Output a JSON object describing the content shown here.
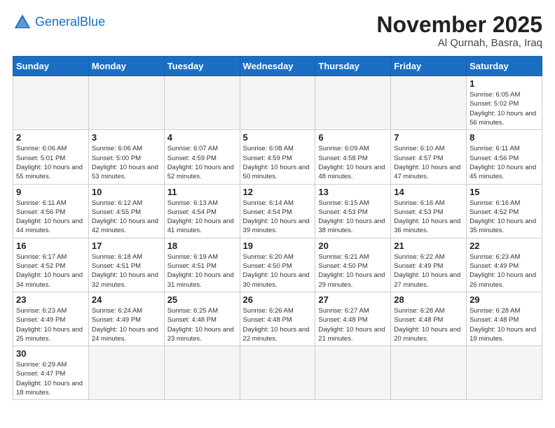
{
  "header": {
    "logo_general": "General",
    "logo_blue": "Blue",
    "month_title": "November 2025",
    "subtitle": "Al Qurnah, Basra, Iraq"
  },
  "weekdays": [
    "Sunday",
    "Monday",
    "Tuesday",
    "Wednesday",
    "Thursday",
    "Friday",
    "Saturday"
  ],
  "weeks": [
    [
      {
        "day": "",
        "info": ""
      },
      {
        "day": "",
        "info": ""
      },
      {
        "day": "",
        "info": ""
      },
      {
        "day": "",
        "info": ""
      },
      {
        "day": "",
        "info": ""
      },
      {
        "day": "",
        "info": ""
      },
      {
        "day": "1",
        "info": "Sunrise: 6:05 AM\nSunset: 5:02 PM\nDaylight: 10 hours and 56 minutes."
      }
    ],
    [
      {
        "day": "2",
        "info": "Sunrise: 6:06 AM\nSunset: 5:01 PM\nDaylight: 10 hours and 55 minutes."
      },
      {
        "day": "3",
        "info": "Sunrise: 6:06 AM\nSunset: 5:00 PM\nDaylight: 10 hours and 53 minutes."
      },
      {
        "day": "4",
        "info": "Sunrise: 6:07 AM\nSunset: 4:59 PM\nDaylight: 10 hours and 52 minutes."
      },
      {
        "day": "5",
        "info": "Sunrise: 6:08 AM\nSunset: 4:59 PM\nDaylight: 10 hours and 50 minutes."
      },
      {
        "day": "6",
        "info": "Sunrise: 6:09 AM\nSunset: 4:58 PM\nDaylight: 10 hours and 48 minutes."
      },
      {
        "day": "7",
        "info": "Sunrise: 6:10 AM\nSunset: 4:57 PM\nDaylight: 10 hours and 47 minutes."
      },
      {
        "day": "8",
        "info": "Sunrise: 6:11 AM\nSunset: 4:56 PM\nDaylight: 10 hours and 45 minutes."
      }
    ],
    [
      {
        "day": "9",
        "info": "Sunrise: 6:11 AM\nSunset: 4:56 PM\nDaylight: 10 hours and 44 minutes."
      },
      {
        "day": "10",
        "info": "Sunrise: 6:12 AM\nSunset: 4:55 PM\nDaylight: 10 hours and 42 minutes."
      },
      {
        "day": "11",
        "info": "Sunrise: 6:13 AM\nSunset: 4:54 PM\nDaylight: 10 hours and 41 minutes."
      },
      {
        "day": "12",
        "info": "Sunrise: 6:14 AM\nSunset: 4:54 PM\nDaylight: 10 hours and 39 minutes."
      },
      {
        "day": "13",
        "info": "Sunrise: 6:15 AM\nSunset: 4:53 PM\nDaylight: 10 hours and 38 minutes."
      },
      {
        "day": "14",
        "info": "Sunrise: 6:16 AM\nSunset: 4:53 PM\nDaylight: 10 hours and 36 minutes."
      },
      {
        "day": "15",
        "info": "Sunrise: 6:16 AM\nSunset: 4:52 PM\nDaylight: 10 hours and 35 minutes."
      }
    ],
    [
      {
        "day": "16",
        "info": "Sunrise: 6:17 AM\nSunset: 4:52 PM\nDaylight: 10 hours and 34 minutes."
      },
      {
        "day": "17",
        "info": "Sunrise: 6:18 AM\nSunset: 4:51 PM\nDaylight: 10 hours and 32 minutes."
      },
      {
        "day": "18",
        "info": "Sunrise: 6:19 AM\nSunset: 4:51 PM\nDaylight: 10 hours and 31 minutes."
      },
      {
        "day": "19",
        "info": "Sunrise: 6:20 AM\nSunset: 4:50 PM\nDaylight: 10 hours and 30 minutes."
      },
      {
        "day": "20",
        "info": "Sunrise: 6:21 AM\nSunset: 4:50 PM\nDaylight: 10 hours and 29 minutes."
      },
      {
        "day": "21",
        "info": "Sunrise: 6:22 AM\nSunset: 4:49 PM\nDaylight: 10 hours and 27 minutes."
      },
      {
        "day": "22",
        "info": "Sunrise: 6:23 AM\nSunset: 4:49 PM\nDaylight: 10 hours and 26 minutes."
      }
    ],
    [
      {
        "day": "23",
        "info": "Sunrise: 6:23 AM\nSunset: 4:49 PM\nDaylight: 10 hours and 25 minutes."
      },
      {
        "day": "24",
        "info": "Sunrise: 6:24 AM\nSunset: 4:49 PM\nDaylight: 10 hours and 24 minutes."
      },
      {
        "day": "25",
        "info": "Sunrise: 6:25 AM\nSunset: 4:48 PM\nDaylight: 10 hours and 23 minutes."
      },
      {
        "day": "26",
        "info": "Sunrise: 6:26 AM\nSunset: 4:48 PM\nDaylight: 10 hours and 22 minutes."
      },
      {
        "day": "27",
        "info": "Sunrise: 6:27 AM\nSunset: 4:48 PM\nDaylight: 10 hours and 21 minutes."
      },
      {
        "day": "28",
        "info": "Sunrise: 6:28 AM\nSunset: 4:48 PM\nDaylight: 10 hours and 20 minutes."
      },
      {
        "day": "29",
        "info": "Sunrise: 6:28 AM\nSunset: 4:48 PM\nDaylight: 10 hours and 19 minutes."
      }
    ],
    [
      {
        "day": "30",
        "info": "Sunrise: 6:29 AM\nSunset: 4:47 PM\nDaylight: 10 hours and 18 minutes."
      },
      {
        "day": "",
        "info": ""
      },
      {
        "day": "",
        "info": ""
      },
      {
        "day": "",
        "info": ""
      },
      {
        "day": "",
        "info": ""
      },
      {
        "day": "",
        "info": ""
      },
      {
        "day": "",
        "info": ""
      }
    ]
  ]
}
